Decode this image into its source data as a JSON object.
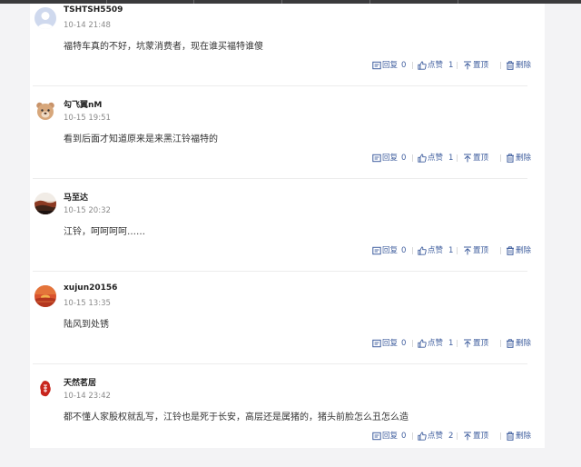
{
  "comments": [
    {
      "username": "TSHTSH5509",
      "time": "10-14 21:48",
      "text": "福特车真的不好，坑蒙消费者，现在谁买福特谁傻",
      "reply_label": "回复",
      "reply_count": "0",
      "like_label": "点赞",
      "like_count": "1",
      "top_label": "置顶",
      "delete_label": "删除",
      "avatar": "default-avatar"
    },
    {
      "username": "勾飞翼nM",
      "time": "10-15 19:51",
      "text": "看到后面才知道原来是来黑江铃福特的",
      "reply_label": "回复",
      "reply_count": "0",
      "like_label": "点赞",
      "like_count": "1",
      "top_label": "置顶",
      "delete_label": "删除",
      "avatar": "bear-avatar"
    },
    {
      "username": "马至达",
      "time": "10-15 20:32",
      "text": "江铃，呵呵呵呵……",
      "reply_label": "回复",
      "reply_count": "0",
      "like_label": "点赞",
      "like_count": "1",
      "top_label": "置顶",
      "delete_label": "删除",
      "avatar": "landscape-avatar"
    },
    {
      "username": "xujun20156",
      "time": "10-15 13:35",
      "text": "陆风到处锈",
      "reply_label": "回复",
      "reply_count": "0",
      "like_label": "点赞",
      "like_count": "1",
      "top_label": "置顶",
      "delete_label": "删除",
      "avatar": "sunset-avatar"
    },
    {
      "username": "天然茗居",
      "time": "10-14 23:42",
      "text": "都不懂人家股权就乱写，江铃也是死于长安，高层还是属猪的，猪头前脸怎么丑怎么造",
      "reply_label": "回复",
      "reply_count": "0",
      "like_label": "点赞",
      "like_count": "2",
      "top_label": "置顶",
      "delete_label": "删除",
      "avatar": "seal-avatar"
    }
  ],
  "colors": {
    "action": "#3f5e9e",
    "text": "#333333",
    "time": "#8a8a8a",
    "divider": "#ececec",
    "background": "#f3f3f5"
  }
}
